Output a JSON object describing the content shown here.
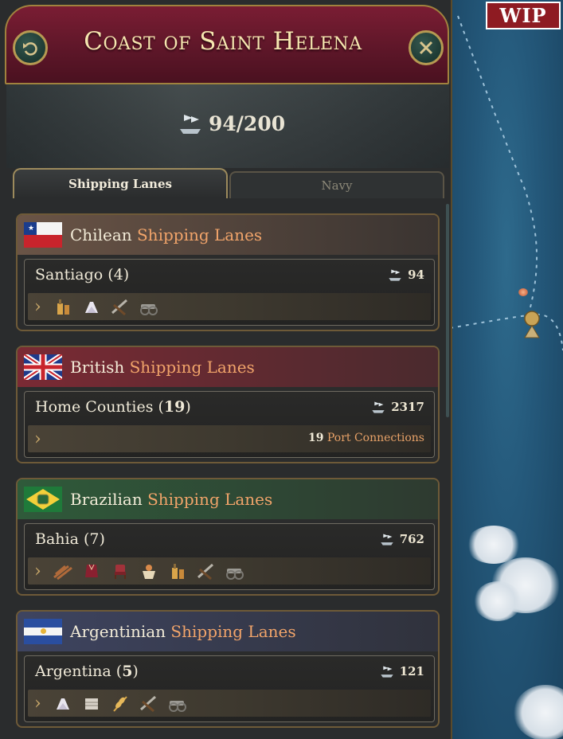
{
  "header": {
    "title": "Coast of Saint Helena",
    "back_icon": "back-arrow-icon",
    "close_icon": "close-icon"
  },
  "capacity": {
    "value": "94/200"
  },
  "tabs": [
    {
      "label": "Shipping Lanes",
      "active": true
    },
    {
      "label": "Navy",
      "active": false
    }
  ],
  "lanes": [
    {
      "nation": "Chilean",
      "suffix": "Shipping Lanes",
      "route": "Santiago",
      "count": "4",
      "ships": "94",
      "goods": [
        "liquor-icon",
        "clothes-icon",
        "small-arms-icon",
        "artillery-icon"
      ],
      "color": "#5c4a3e"
    },
    {
      "nation": "British",
      "suffix": "Shipping Lanes",
      "route": "Home Counties",
      "count": "19",
      "ships": "2317",
      "port_count": "19",
      "port_label": "Port Connections",
      "color": "#6a2a32"
    },
    {
      "nation": "Brazilian",
      "suffix": "Shipping Lanes",
      "route": "Bahia",
      "count": "7",
      "ships": "762",
      "goods": [
        "wood-icon",
        "luxury-clothes-icon",
        "furniture-icon",
        "groceries-icon",
        "liquor-icon",
        "small-arms-icon",
        "artillery-icon"
      ],
      "color": "#2b4a33"
    },
    {
      "nation": "Argentinian",
      "suffix": "Shipping Lanes",
      "route": "Argentina",
      "count": "5",
      "ships": "121",
      "goods": [
        "clothes-icon",
        "luxury-clothes-icon",
        "grain-icon",
        "small-arms-icon",
        "artillery-icon"
      ],
      "color": "#3a3f58"
    }
  ],
  "badge": {
    "label": "WIP"
  }
}
